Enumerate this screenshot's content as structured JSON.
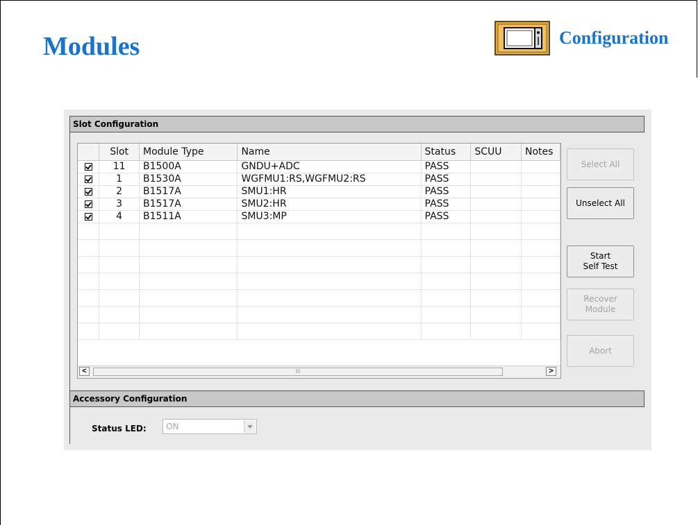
{
  "slide": {
    "title": "Modules",
    "section_label": "Configuration"
  },
  "colors": {
    "title_blue": "#1a75c9",
    "badge_gold": "#e8a93a"
  },
  "icons": {
    "config_badge": "monitor-icon"
  },
  "slot_section": {
    "header": "Slot Configuration",
    "columns": [
      "",
      "Slot",
      "Module Type",
      "Name",
      "Status",
      "SCUU",
      "Notes"
    ],
    "rows": [
      {
        "checked": true,
        "slot": "11",
        "module_type": "B1500A",
        "name": "GNDU+ADC",
        "status": "PASS",
        "scuu": "",
        "notes": ""
      },
      {
        "checked": true,
        "slot": "1",
        "module_type": "B1530A",
        "name": "WGFMU1:RS,WGFMU2:RS",
        "status": "PASS",
        "scuu": "",
        "notes": ""
      },
      {
        "checked": true,
        "slot": "2",
        "module_type": "B1517A",
        "name": "SMU1:HR",
        "status": "PASS",
        "scuu": "",
        "notes": ""
      },
      {
        "checked": true,
        "slot": "3",
        "module_type": "B1517A",
        "name": "SMU2:HR",
        "status": "PASS",
        "scuu": "",
        "notes": ""
      },
      {
        "checked": true,
        "slot": "4",
        "module_type": "B1511A",
        "name": "SMU3:MP",
        "status": "PASS",
        "scuu": "",
        "notes": ""
      }
    ],
    "empty_rows": 7
  },
  "buttons": {
    "select_all": {
      "label": "Select All",
      "enabled": false
    },
    "unselect_all": {
      "label": "Unselect All",
      "enabled": true
    },
    "start_self_test": {
      "label": "Start\nSelf Test",
      "enabled": true
    },
    "recover_module": {
      "label": "Recover\nModule",
      "enabled": false
    },
    "abort": {
      "label": "Abort",
      "enabled": false
    }
  },
  "scrollbar": {
    "left_arrow": "<",
    "right_arrow": ">",
    "thumb_grip": "III"
  },
  "accessory_section": {
    "header": "Accessory Configuration",
    "status_led_label": "Status LED:",
    "status_led_value": "ON"
  }
}
